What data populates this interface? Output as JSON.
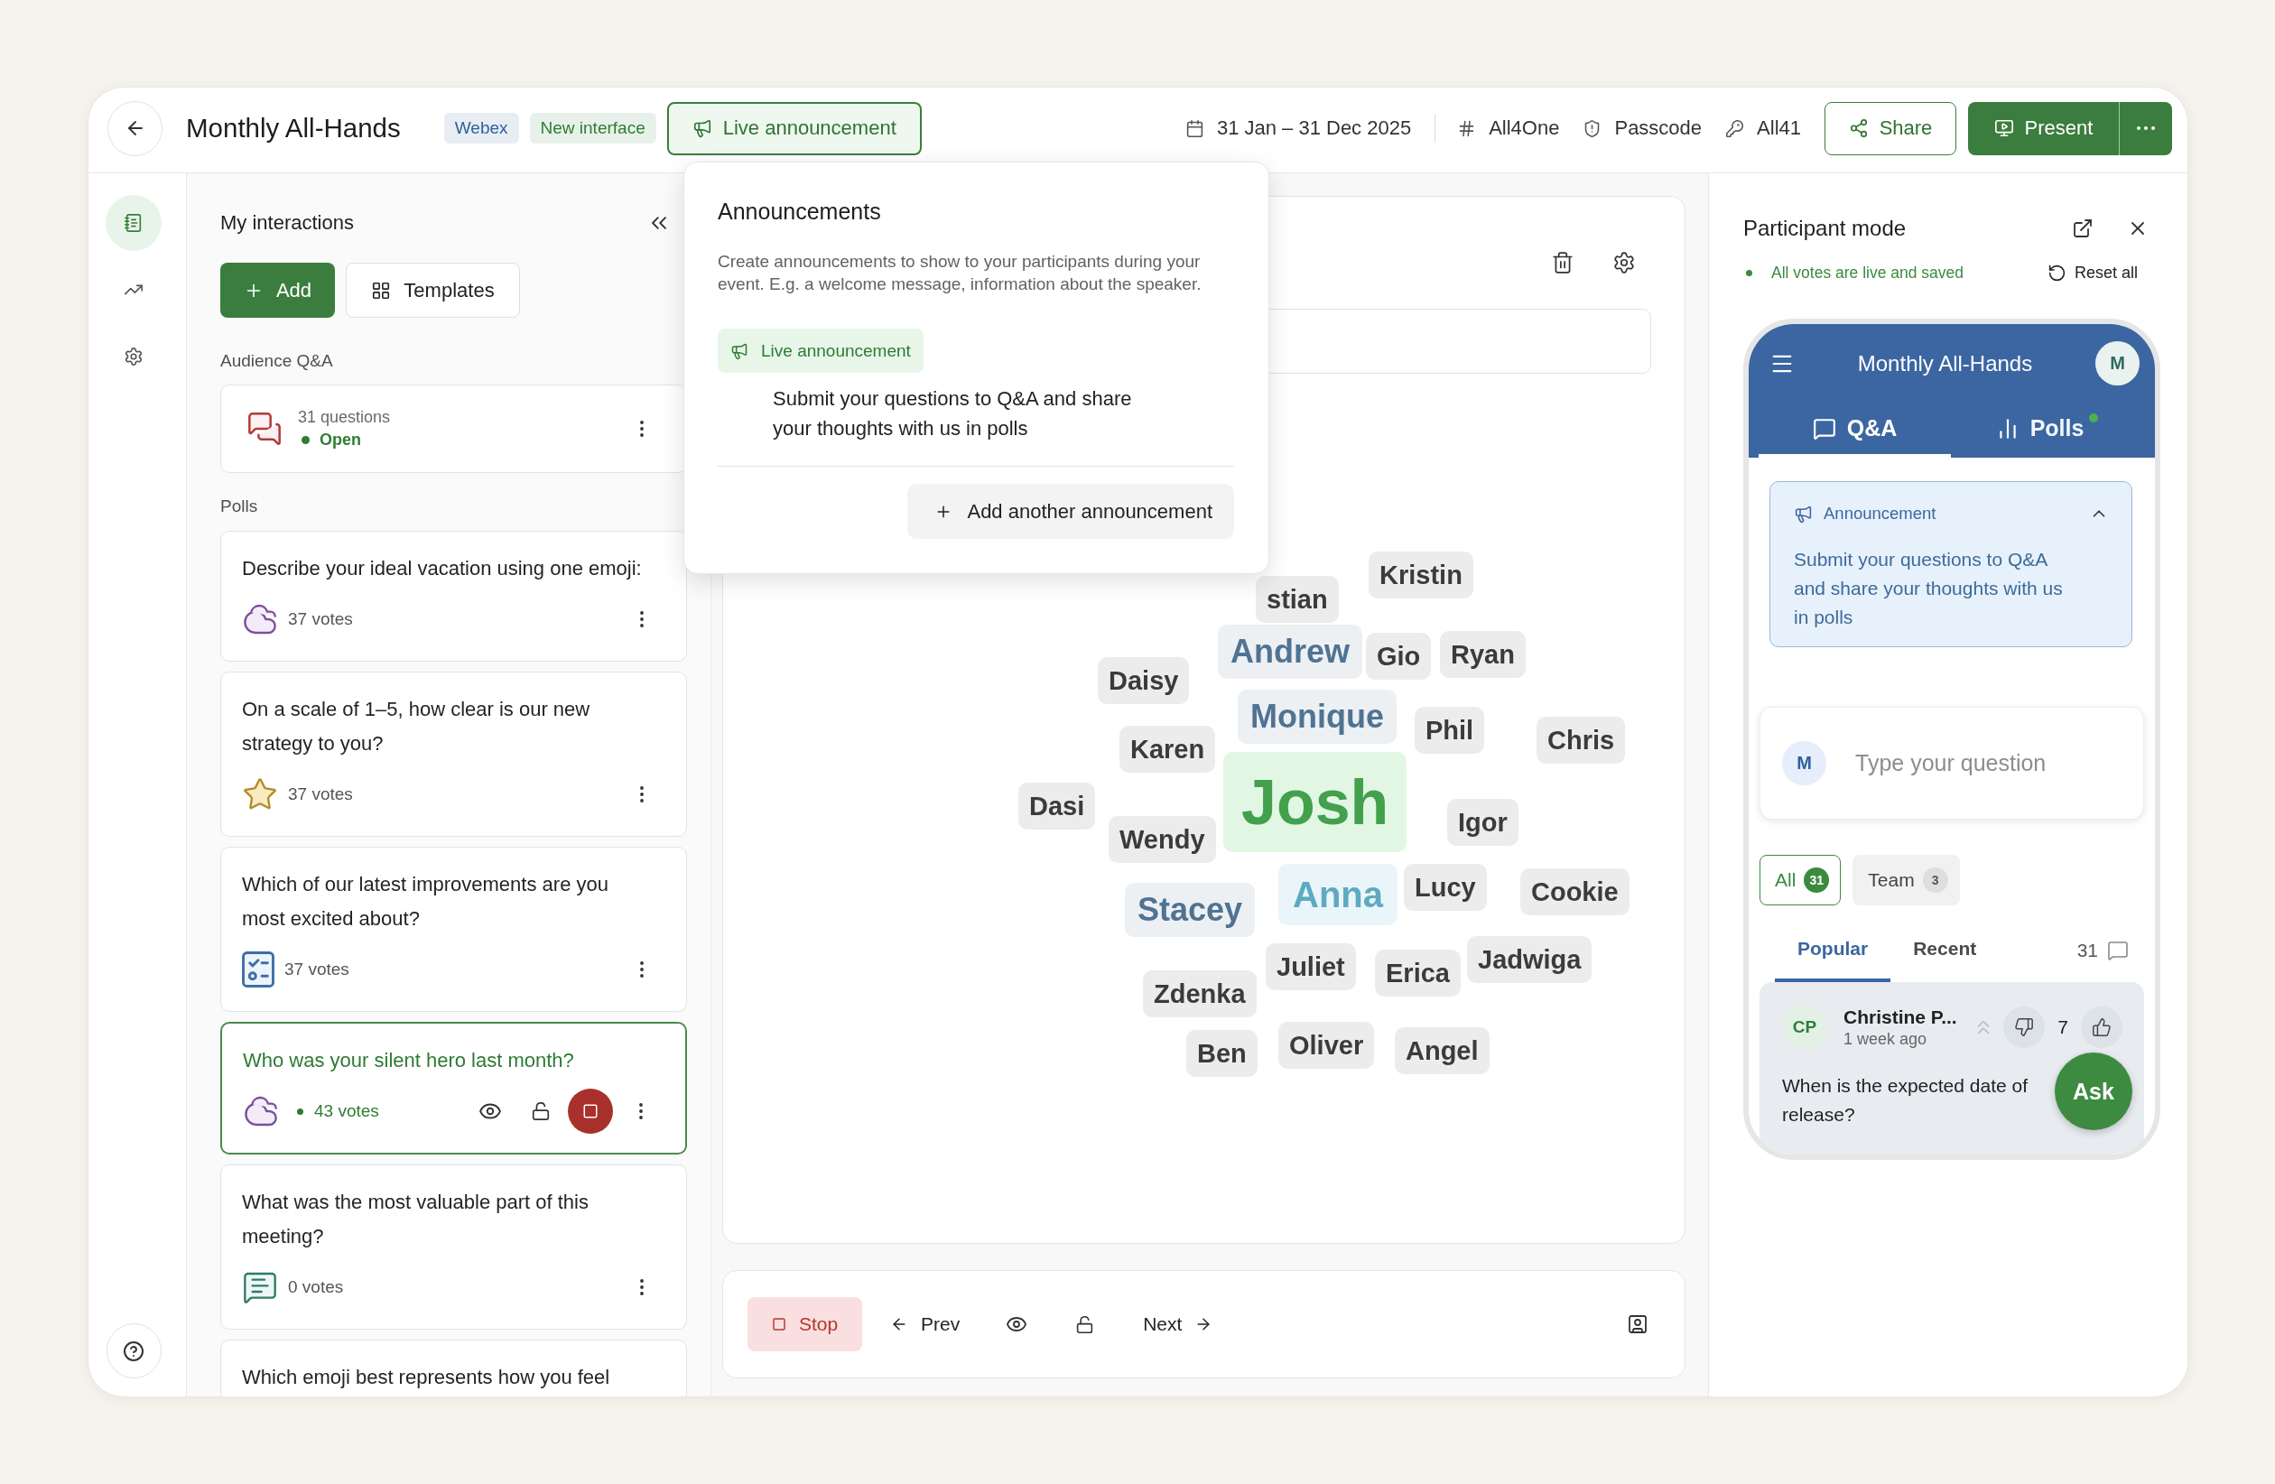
{
  "event": {
    "title": "Monthly All-Hands",
    "badges": [
      {
        "label": "Webex",
        "color": "#2f5f9c"
      },
      {
        "label": "New interface",
        "color": "#2f7d36"
      }
    ],
    "announcement_button": {
      "label": "Live announcement",
      "expanded": true
    },
    "details": [
      {
        "kind": "calendar",
        "text": "31 Jan – 31 Dec 2025"
      },
      {
        "kind": "hash",
        "text": "All4One"
      },
      {
        "kind": "shield",
        "text": "Passcode"
      },
      {
        "kind": "key",
        "text": "All41"
      }
    ],
    "share_button": "Share",
    "present_button": "Present"
  },
  "nav_rail": [
    {
      "kind": "interactions",
      "selected": true
    },
    {
      "kind": "analytics",
      "selected": false
    },
    {
      "kind": "settings",
      "selected": false
    }
  ],
  "interactions": {
    "title": "My interactions",
    "add_button": "Add",
    "templates_button": "Templates",
    "qa_section": "Audience Q&A",
    "qa": {
      "count": "31 questions",
      "status": "Open"
    },
    "polls_section": "Polls",
    "polls": [
      {
        "question": "Describe your ideal vacation using one emoji:",
        "kind": "wordcloud",
        "votes": "37 votes",
        "selected": false,
        "live": false
      },
      {
        "question": "On a scale of 1–5, how clear is our new strategy to you?",
        "kind": "rating",
        "votes": "37 votes",
        "selected": false,
        "live": false
      },
      {
        "question": "Which of our latest improvements are you most excited about?",
        "kind": "multiple_choice",
        "votes": "37 votes",
        "selected": false,
        "live": false
      },
      {
        "question": "Who was your silent hero last month?",
        "kind": "wordcloud",
        "votes": "43 votes",
        "selected": true,
        "live": true
      },
      {
        "question": "What was the most valuable part of this meeting?",
        "kind": "open_text",
        "votes": "0 votes",
        "selected": false,
        "live": false
      },
      {
        "question": "Which emoji best represents how you feel",
        "selected": false,
        "live": false
      }
    ]
  },
  "announcements_popup": {
    "title": "Announcements",
    "description": "Create announcements to show to your participants during your event. E.g. a welcome message, information about the speaker.",
    "items": [
      {
        "tag": "Live announcement",
        "text": "Submit your questions to Q&A and share your thoughts with us in polls"
      }
    ],
    "add_button": "Add another announcement"
  },
  "word_cloud": {
    "words": [
      {
        "text": "stian",
        "kind": "base"
      },
      {
        "text": "Kristin",
        "kind": "base"
      },
      {
        "text": "Daisy",
        "kind": "base"
      },
      {
        "text": "Andrew",
        "kind": "mid"
      },
      {
        "text": "Gio",
        "kind": "base"
      },
      {
        "text": "Ryan",
        "kind": "base"
      },
      {
        "text": "Karen",
        "kind": "base"
      },
      {
        "text": "Monique",
        "kind": "mid"
      },
      {
        "text": "Phil",
        "kind": "base"
      },
      {
        "text": "Chris",
        "kind": "base"
      },
      {
        "text": "Dasi",
        "kind": "base"
      },
      {
        "text": "Wendy",
        "kind": "base"
      },
      {
        "text": "Josh",
        "kind": "top"
      },
      {
        "text": "Igor",
        "kind": "base"
      },
      {
        "text": "Stacey",
        "kind": "mid"
      },
      {
        "text": "Anna",
        "kind": "high"
      },
      {
        "text": "Lucy",
        "kind": "base"
      },
      {
        "text": "Cookie",
        "kind": "base"
      },
      {
        "text": "Zdenka",
        "kind": "base"
      },
      {
        "text": "Juliet",
        "kind": "base"
      },
      {
        "text": "Erica",
        "kind": "base"
      },
      {
        "text": "Jadwiga",
        "kind": "base"
      },
      {
        "text": "Ben",
        "kind": "base"
      },
      {
        "text": "Oliver",
        "kind": "base"
      },
      {
        "text": "Angel",
        "kind": "base"
      }
    ]
  },
  "presenter_controls": {
    "stop": "Stop",
    "prev": "Prev",
    "next": "Next"
  },
  "participant_panel": {
    "title": "Participant mode",
    "status": "All votes are live and saved",
    "reset_button": "Reset all",
    "phone": {
      "title": "Monthly All-Hands",
      "avatar": "M",
      "tabs": [
        {
          "label": "Q&A",
          "kind": "qa",
          "selected": true,
          "new": false
        },
        {
          "label": "Polls",
          "kind": "polls",
          "selected": false,
          "new": true
        }
      ],
      "announcement": {
        "label": "Announcement",
        "expanded": true,
        "text": "Submit your questions to Q&A and share your thoughts with us in polls"
      },
      "question_input": {
        "avatar": "M",
        "placeholder": "Type your question"
      },
      "filters": [
        {
          "label": "All",
          "count": "31",
          "selected": true
        },
        {
          "label": "Team",
          "count": "3",
          "selected": false
        }
      ],
      "sort_tabs": [
        {
          "label": "Popular",
          "selected": true
        },
        {
          "label": "Recent",
          "selected": false
        }
      ],
      "question_count": "31",
      "questions": [
        {
          "initials": "CP",
          "author": "Christine P...",
          "time": "1 week ago",
          "votes": "7",
          "text": "When is the expected date of release?"
        }
      ],
      "ask_button": "Ask"
    }
  }
}
